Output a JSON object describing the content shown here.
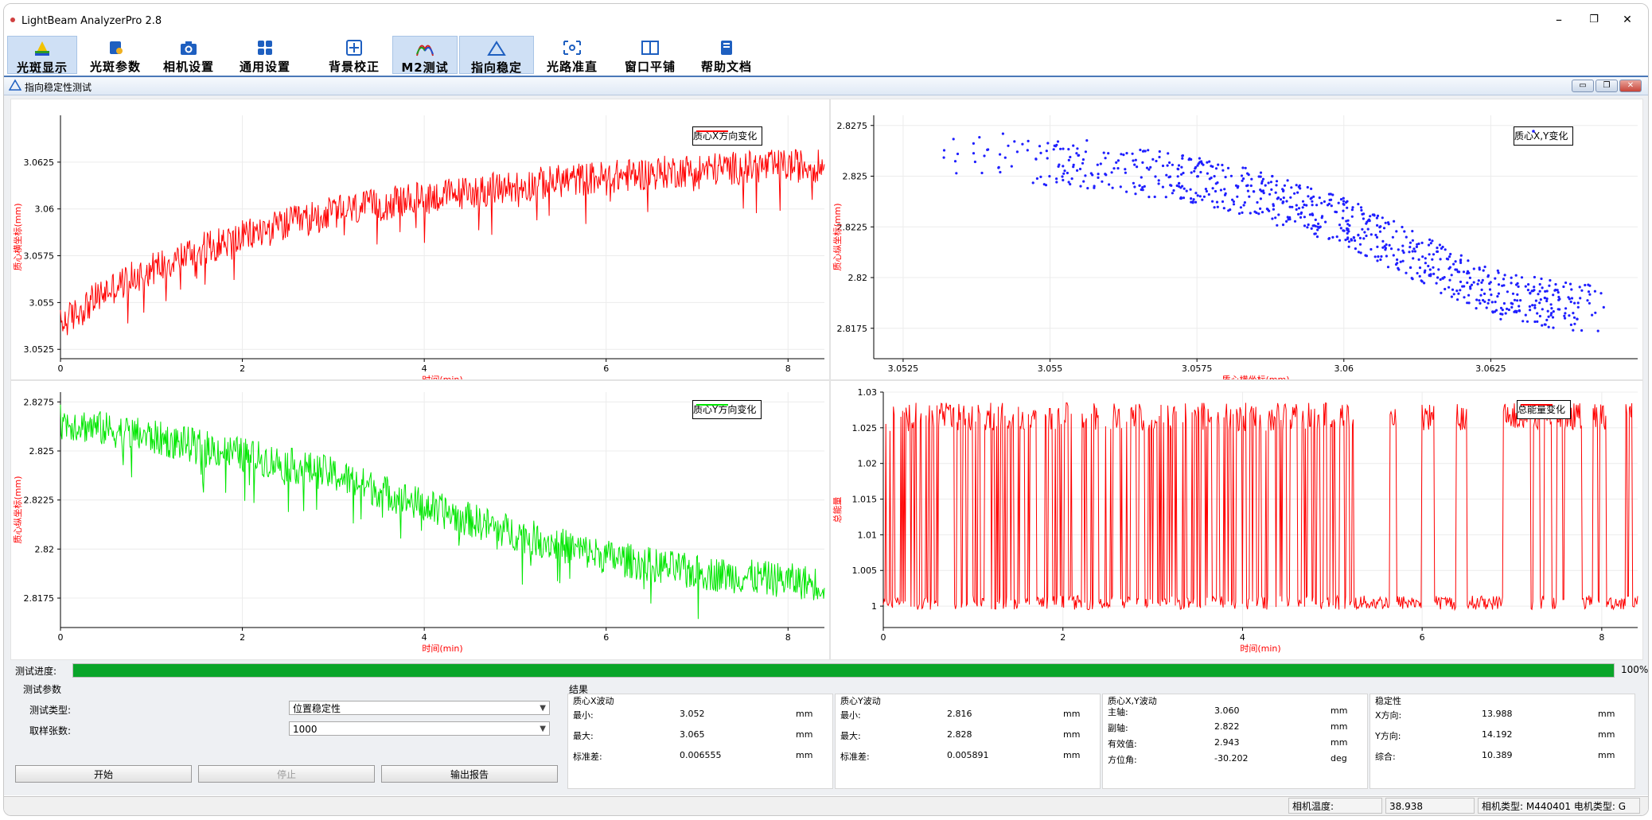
{
  "window": {
    "title": "LightBeam AnalyzerPro 2.8",
    "controls": [
      "–",
      "❐",
      "✕"
    ]
  },
  "toolbar": {
    "items": [
      {
        "label": "光斑显示",
        "icon": "prism-icon",
        "active": true
      },
      {
        "label": "光斑参数",
        "icon": "spot-params-icon",
        "active": false
      },
      {
        "label": "相机设置",
        "icon": "camera-icon",
        "active": false
      },
      {
        "label": "通用设置",
        "icon": "grid-settings-icon",
        "active": false
      },
      {
        "label": "背景校正",
        "icon": "background-correct-icon",
        "active": false
      },
      {
        "label": "M2测试",
        "icon": "m2-curve-icon",
        "active": true
      },
      {
        "label": "指向稳定",
        "icon": "triangle-stability-icon",
        "active": true
      },
      {
        "label": "光路准直",
        "icon": "alignment-icon",
        "active": false
      },
      {
        "label": "窗口平铺",
        "icon": "tile-windows-icon",
        "active": false
      },
      {
        "label": "帮助文档",
        "icon": "help-book-icon",
        "active": false
      }
    ]
  },
  "subwindow": {
    "title": "指向稳定性测试",
    "buttons": [
      "▭",
      "❐",
      "✕"
    ]
  },
  "colors": {
    "red_series": "#ff0000",
    "green_series": "#00e600",
    "blue_series": "#1f1fff",
    "progress": "#0aa52a",
    "toolbar_active": "#cfe0f5"
  },
  "chart_data": [
    {
      "type": "line",
      "legend": "质心X方向变化",
      "xlabel": "时间(min)",
      "ylabel": "质心横坐标(mm)",
      "xlim": [
        0,
        8.4
      ],
      "ylim": [
        3.052,
        3.065
      ],
      "xticks": [
        0,
        2,
        4,
        6,
        8
      ],
      "yticks": [
        3.0525,
        3.055,
        3.0575,
        3.06,
        3.0625
      ],
      "ytick_labels": [
        "3.0525",
        "3.055",
        "3.0575",
        "3.06",
        "3.0625"
      ],
      "series": [
        {
          "color": "#ff0000",
          "x": [
            0,
            0.5,
            1,
            1.5,
            2,
            2.5,
            3,
            3.5,
            4,
            4.5,
            5,
            5.5,
            6,
            6.5,
            7,
            7.5,
            8,
            8.4
          ],
          "y": [
            3.0538,
            3.0556,
            3.0568,
            3.0578,
            3.0585,
            3.0592,
            3.0598,
            3.0602,
            3.0606,
            3.0609,
            3.0612,
            3.0615,
            3.0617,
            3.0619,
            3.0621,
            3.0622,
            3.0623,
            3.0623
          ]
        }
      ],
      "noise": 0.0009
    },
    {
      "type": "scatter",
      "legend": "质心X,Y变化",
      "xlabel": "质心横坐标(mm)",
      "ylabel": "质心纵坐标(mm)",
      "xlim": [
        3.052,
        3.065
      ],
      "ylim": [
        2.816,
        2.828
      ],
      "xticks": [
        3.0525,
        3.055,
        3.0575,
        3.06,
        3.0625
      ],
      "xtick_labels": [
        "3.0525",
        "3.055",
        "3.0575",
        "3.06",
        "3.0625"
      ],
      "yticks": [
        2.8175,
        2.82,
        2.8225,
        2.825,
        2.8275
      ],
      "ytick_labels": [
        "2.8175",
        "2.82",
        "2.8225",
        "2.825",
        "2.8275"
      ],
      "series": [
        {
          "color": "#1f1fff",
          "trend_x": [
            3.053,
            3.056,
            3.058,
            3.06,
            3.0625,
            3.064
          ],
          "trend_y": [
            2.8262,
            2.8255,
            2.8245,
            2.8228,
            2.8192,
            2.8185
          ]
        }
      ],
      "noise": 0.0012
    },
    {
      "type": "line",
      "legend": "质心Y方向变化",
      "xlabel": "时间(min)",
      "ylabel": "质心纵坐标(mm)",
      "xlim": [
        0,
        8.4
      ],
      "ylim": [
        2.816,
        2.828
      ],
      "xticks": [
        0,
        2,
        4,
        6,
        8
      ],
      "yticks": [
        2.8175,
        2.82,
        2.8225,
        2.825,
        2.8275
      ],
      "ytick_labels": [
        "2.8175",
        "2.82",
        "2.8225",
        "2.825",
        "2.8275"
      ],
      "series": [
        {
          "color": "#00e600",
          "x": [
            0,
            1,
            2,
            3,
            4,
            5,
            6,
            7,
            8,
            8.4
          ],
          "y": [
            2.8265,
            2.8257,
            2.8248,
            2.8238,
            2.8222,
            2.8208,
            2.8196,
            2.8188,
            2.8184,
            2.8182
          ]
        }
      ],
      "noise": 0.0009
    },
    {
      "type": "line",
      "legend": "总能量变化",
      "xlabel": "时间(min)",
      "ylabel": "总能量",
      "xlim": [
        0,
        8.4
      ],
      "ylim": [
        0.997,
        1.03
      ],
      "xticks": [
        0,
        2,
        4,
        6,
        8
      ],
      "yticks": [
        1,
        1.005,
        1.01,
        1.015,
        1.02,
        1.025,
        1.03
      ],
      "ytick_labels": [
        "1",
        "1.005",
        "1.01",
        "1.015",
        "1.02",
        "1.025",
        "1.03"
      ],
      "series": [
        {
          "color": "#ff0000",
          "baseline": 1.0005,
          "peak": 1.0285
        }
      ]
    }
  ],
  "progress": {
    "label": "测试进度:",
    "value": 1.0,
    "text": "100%"
  },
  "params": {
    "group_title": "测试参数",
    "type_label": "测试类型:",
    "type_value": "位置稳定性",
    "samples_label": "取样张数:",
    "samples_value": "1000",
    "start_button": "开始",
    "stop_button": "停止",
    "report_button": "输出报告"
  },
  "results": {
    "title": "结果",
    "x_fluct": {
      "title": "质心X波动",
      "min_label": "最小:",
      "min": "3.052",
      "max_label": "最大:",
      "max": "3.065",
      "std_label": "标准差:",
      "std": "0.006555",
      "unit": "mm"
    },
    "y_fluct": {
      "title": "质心Y波动",
      "min_label": "最小:",
      "min": "2.816",
      "max_label": "最大:",
      "max": "2.828",
      "std_label": "标准差:",
      "std": "0.005891",
      "unit": "mm"
    },
    "xy_fluct": {
      "title": "质心X,Y波动",
      "major_label": "主轴:",
      "major": "3.060",
      "minor_label": "副轴:",
      "minor": "2.822",
      "rms_label": "有效值:",
      "rms": "2.943",
      "angle_label": "方位角:",
      "angle": "-30.202",
      "unit": "mm",
      "angle_unit": "deg"
    },
    "stability": {
      "title": "稳定性",
      "x_label": "X方向:",
      "x": "13.988",
      "y_label": "Y方向:",
      "y": "14.192",
      "total_label": "综合:",
      "total": "10.389",
      "unit": "mm"
    }
  },
  "status": {
    "temp_label": "相机温度:",
    "temp_value": "38.938",
    "camera_text": "相机类型: M440401 电机类型: G"
  }
}
